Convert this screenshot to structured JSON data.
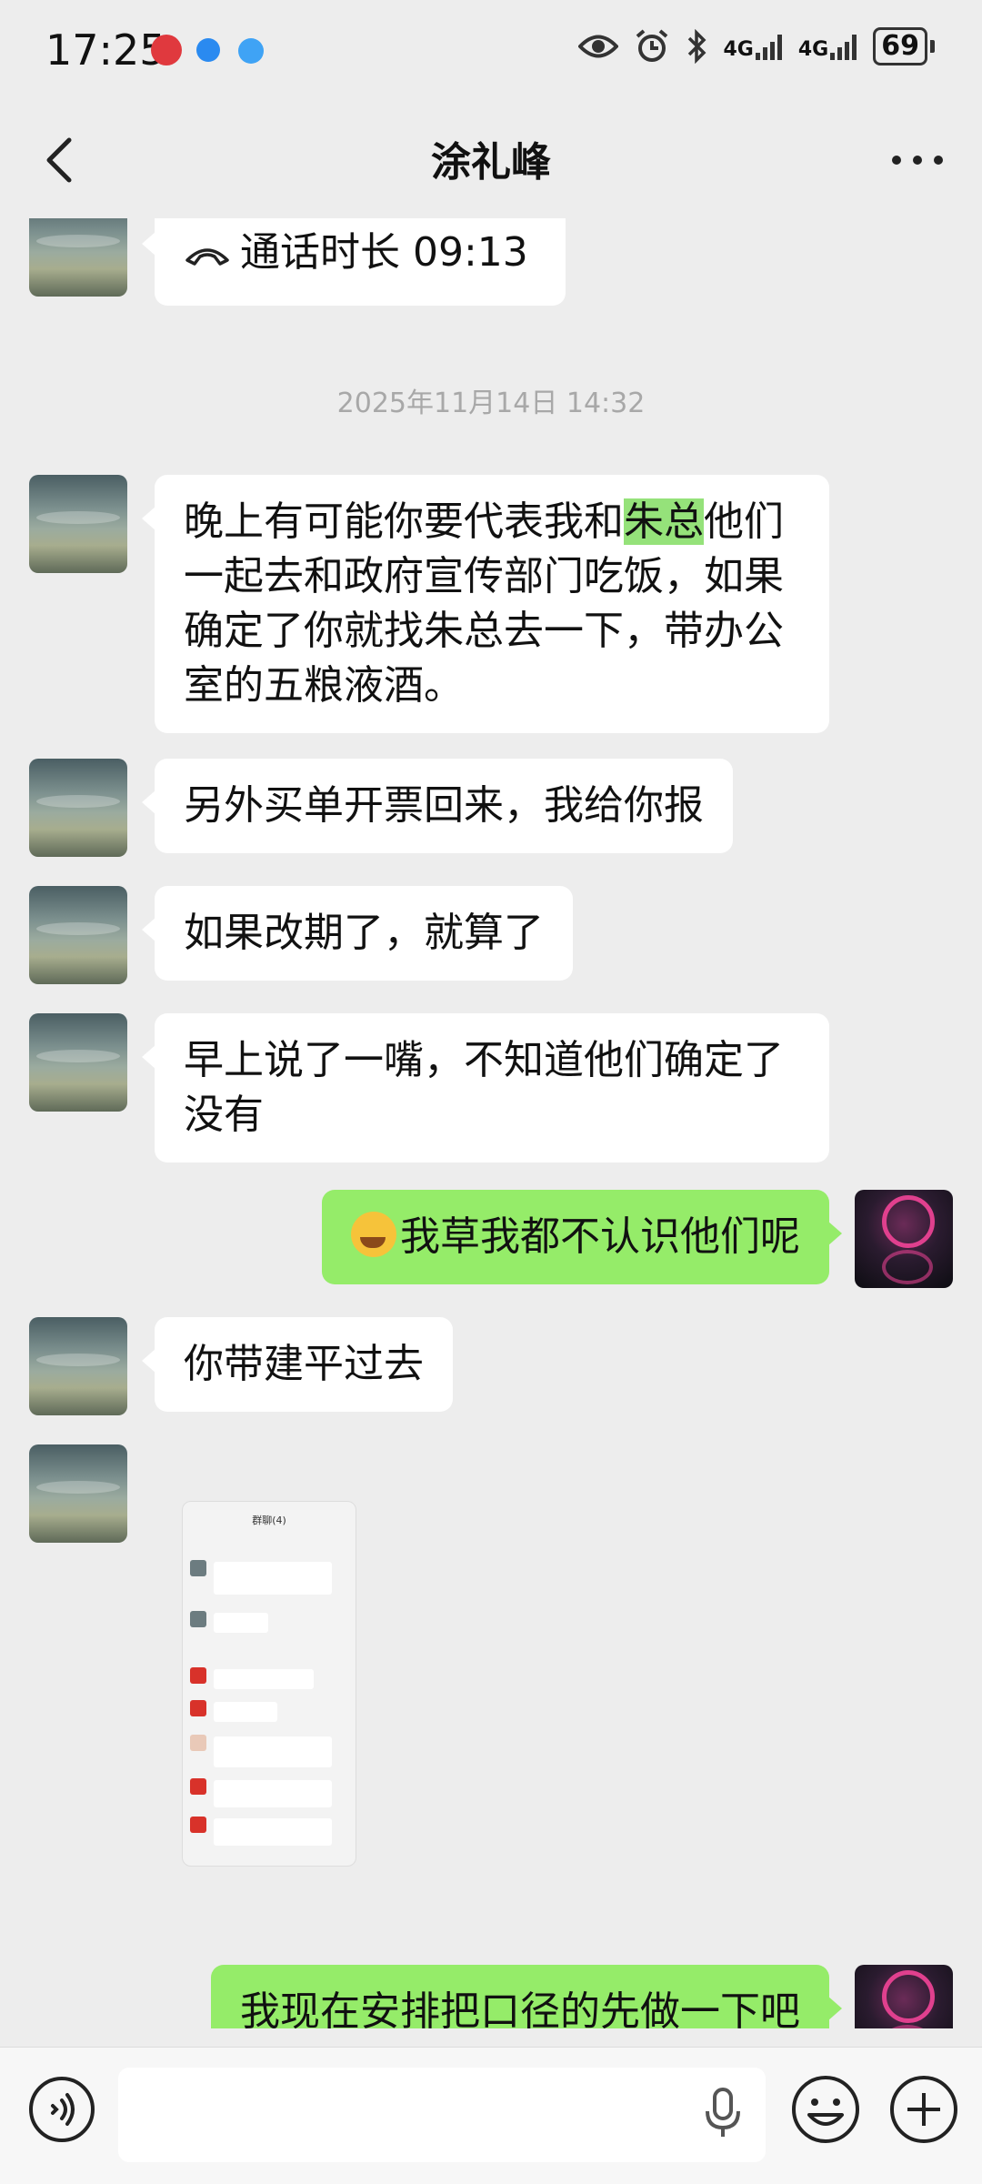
{
  "status_bar": {
    "time": "17:25",
    "battery": "69",
    "network1": "4G",
    "network2": "4G"
  },
  "nav": {
    "title": "涂礼峰",
    "back_icon": "chevron-left-icon",
    "more_icon": "more-dots-icon"
  },
  "messages": {
    "call": "通话时长 09:13",
    "timestamp": "2025年11月14日 14:32",
    "m1_pre": "晚上有可能你要代表我和",
    "m1_hl": "朱总",
    "m1_line1_post": "他们",
    "m1_rest_l2": "一起去和政府宣传部门吃饭，如果",
    "m1_rest_l3": "确定了你就找朱总去一下，带办公",
    "m1_rest_l4": "室的五粮液酒。",
    "m2": "另外买单开票回来，我给你报",
    "m3": "如果改期了，就算了",
    "m4_l1": "早上说了一嘴，不知道他们确定了",
    "m4_l2": "没有",
    "m5": "我草我都不认识他们呢",
    "m6": "你带建平过去",
    "m8": "我现在安排把口径的先做一下吧"
  },
  "thumbnail": {
    "title": "群聊(4)"
  },
  "colors": {
    "background": "#ededed",
    "outgoing_bubble": "#95ec69",
    "incoming_bubble": "#ffffff"
  }
}
